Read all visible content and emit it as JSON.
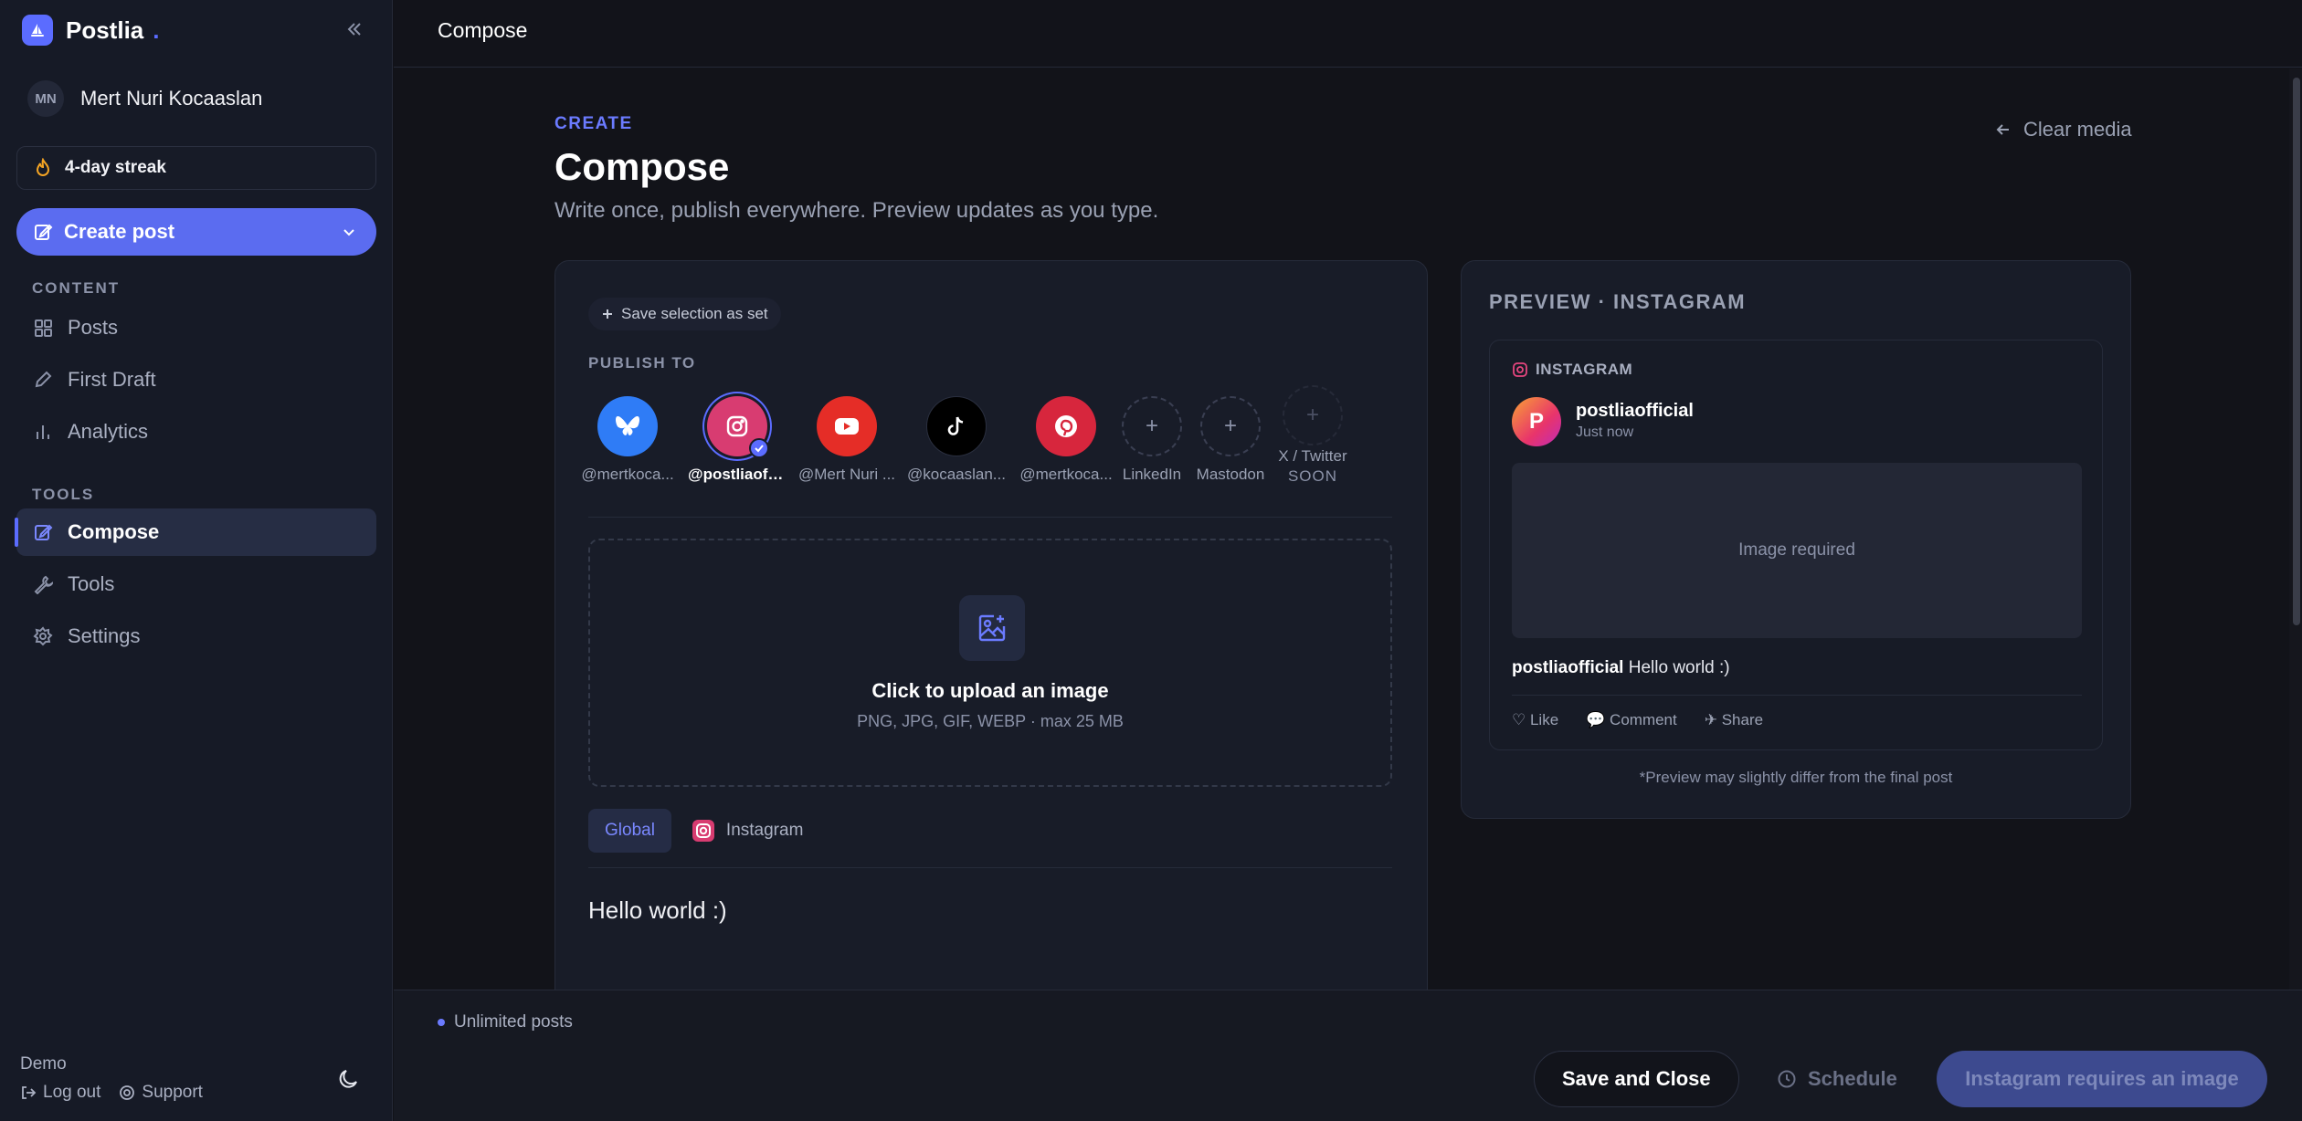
{
  "brand": {
    "name": "Postlia",
    "dot": "."
  },
  "user": {
    "initials": "MN",
    "name": "Mert Nuri Kocaaslan"
  },
  "streak": {
    "label": "4-day streak"
  },
  "create_post": {
    "label": "Create post"
  },
  "sidebar": {
    "content_label": "CONTENT",
    "content_items": [
      {
        "label": "Posts",
        "icon": "grid-icon"
      },
      {
        "label": "First Draft",
        "icon": "pen-icon"
      },
      {
        "label": "Analytics",
        "icon": "bar-chart-icon"
      }
    ],
    "tools_label": "TOOLS",
    "tools_items": [
      {
        "label": "Compose",
        "icon": "edit-icon",
        "active": true
      },
      {
        "label": "Tools",
        "icon": "wrench-icon"
      },
      {
        "label": "Settings",
        "icon": "gear-icon"
      }
    ],
    "demo_label": "Demo",
    "logout_label": "Log out",
    "support_label": "Support"
  },
  "topbar": {
    "title": "Compose"
  },
  "header": {
    "kicker": "CREATE",
    "title": "Compose",
    "subtitle": "Write once, publish everywhere. Preview updates as you type.",
    "clear_media": "Clear media"
  },
  "editor": {
    "save_set_label": "Save selection as set",
    "publish_to_label": "PUBLISH TO",
    "accounts": [
      {
        "platform": "Bluesky",
        "handle": "@mertkoca...",
        "color": "#2f7cf6"
      },
      {
        "platform": "Instagram",
        "handle": "@postliaoffi...",
        "color": "#d83c71",
        "selected": true
      },
      {
        "platform": "YouTube",
        "handle": "@Mert Nuri ...",
        "color": "#e52d27"
      },
      {
        "platform": "TikTok",
        "handle": "@kocaaslan...",
        "color": "#000000"
      },
      {
        "platform": "Pinterest",
        "handle": "@mertkoca...",
        "color": "#d7263d"
      }
    ],
    "add_accounts": [
      {
        "label": "LinkedIn"
      },
      {
        "label": "Mastodon"
      },
      {
        "label": "X / Twitter",
        "badge": "SOON"
      }
    ],
    "upload": {
      "title": "Click to upload an image",
      "subtitle": "PNG, JPG, GIF, WEBP · max 25 MB"
    },
    "tabs": [
      {
        "label": "Global",
        "active": true
      },
      {
        "label": "Instagram"
      }
    ],
    "text": "Hello world :)"
  },
  "preview": {
    "title": "PREVIEW · INSTAGRAM",
    "platform_tag": "INSTAGRAM",
    "avatar_letter": "P",
    "username": "postliaofficial",
    "time": "Just now",
    "image_placeholder": "Image required",
    "caption_user": "postliaofficial",
    "caption_text": "Hello world :)",
    "actions": {
      "like": "Like",
      "comment": "Comment",
      "share": "Share"
    },
    "note": "*Preview may slightly differ from the final post"
  },
  "footer": {
    "unlimited": "Unlimited posts",
    "save_close": "Save and Close",
    "schedule": "Schedule",
    "publish": "Instagram requires an image"
  }
}
